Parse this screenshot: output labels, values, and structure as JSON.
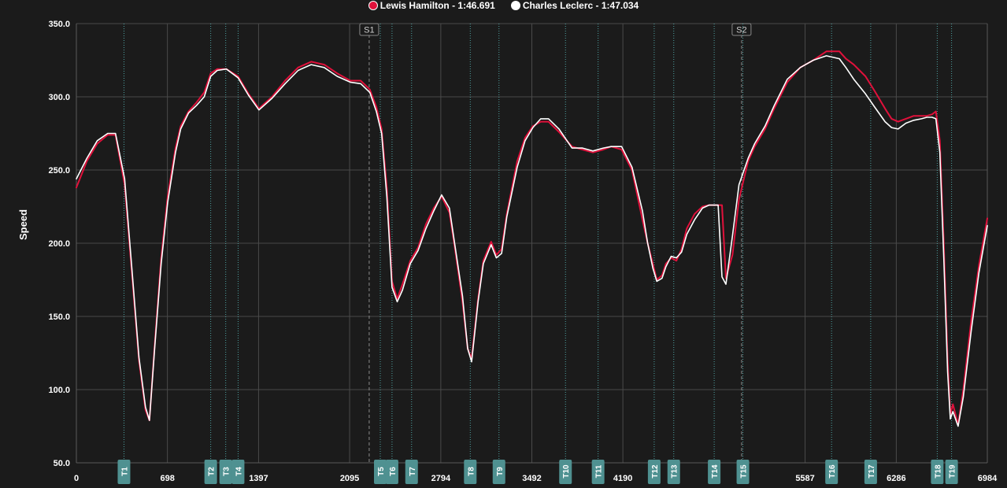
{
  "chart_data": {
    "type": "line",
    "ylabel": "Speed",
    "ylim": [
      50,
      350
    ],
    "xlim": [
      0,
      6984
    ],
    "yticks": [
      "350.0",
      "300.0",
      "250.0",
      "200.0",
      "150.0",
      "100.0",
      "50.0"
    ],
    "yticks_values": [
      350,
      300,
      250,
      200,
      150,
      100,
      50
    ],
    "xticks": [
      "0",
      "698",
      "1397",
      "2095",
      "2794",
      "3492",
      "4190",
      "5587",
      "6286",
      "6984"
    ],
    "xticks_values": [
      0,
      698,
      1397,
      2095,
      2794,
      3492,
      4190,
      5587,
      6286,
      6984
    ],
    "grid": true,
    "legend_position": "top-center",
    "sectors": [
      {
        "label": "S1",
        "x": 2245
      },
      {
        "label": "S2",
        "x": 5100
      }
    ],
    "turns": [
      {
        "label": "T1",
        "x": 365
      },
      {
        "label": "T2",
        "x": 1030
      },
      {
        "label": "T3",
        "x": 1145
      },
      {
        "label": "T4",
        "x": 1240
      },
      {
        "label": "T5",
        "x": 2330
      },
      {
        "label": "T6",
        "x": 2420
      },
      {
        "label": "T7",
        "x": 2570
      },
      {
        "label": "T8",
        "x": 3020
      },
      {
        "label": "T9",
        "x": 3240
      },
      {
        "label": "T10",
        "x": 3750
      },
      {
        "label": "T11",
        "x": 4000
      },
      {
        "label": "T12",
        "x": 4430
      },
      {
        "label": "T13",
        "x": 4580
      },
      {
        "label": "T14",
        "x": 4890
      },
      {
        "label": "T15",
        "x": 5110
      },
      {
        "label": "T16",
        "x": 5790
      },
      {
        "label": "T17",
        "x": 6090
      },
      {
        "label": "T18",
        "x": 6600
      },
      {
        "label": "T19",
        "x": 6710
      }
    ],
    "series": [
      {
        "name": "Lewis Hamilton - 1:46.691",
        "color": "#e0113b",
        "x": [
          0,
          80,
          160,
          240,
          300,
          370,
          430,
          480,
          530,
          560,
          600,
          650,
          700,
          760,
          800,
          860,
          920,
          980,
          1030,
          1080,
          1150,
          1240,
          1320,
          1400,
          1500,
          1600,
          1700,
          1800,
          1900,
          2000,
          2100,
          2180,
          2250,
          2300,
          2340,
          2380,
          2420,
          2460,
          2500,
          2560,
          2620,
          2680,
          2740,
          2800,
          2860,
          2900,
          2960,
          3000,
          3030,
          3080,
          3120,
          3180,
          3220,
          3260,
          3300,
          3380,
          3440,
          3500,
          3560,
          3620,
          3700,
          3800,
          3880,
          3960,
          4040,
          4100,
          4180,
          4260,
          4340,
          4380,
          4420,
          4450,
          4490,
          4520,
          4560,
          4600,
          4640,
          4680,
          4740,
          4800,
          4850,
          4900,
          4920,
          4950,
          4980,
          5030,
          5080,
          5150,
          5200,
          5280,
          5350,
          5450,
          5550,
          5650,
          5750,
          5850,
          5900,
          5960,
          6050,
          6120,
          6200,
          6250,
          6300,
          6360,
          6420,
          6480,
          6520,
          6560,
          6590,
          6620,
          6650,
          6680,
          6700,
          6720,
          6760,
          6800,
          6860,
          6920,
          6984
        ],
        "values": [
          238,
          256,
          268,
          274,
          274,
          240,
          175,
          120,
          86,
          79,
          130,
          190,
          232,
          265,
          280,
          290,
          296,
          303,
          316,
          319,
          319,
          314,
          302,
          292,
          300,
          311,
          320,
          324,
          322,
          316,
          311,
          311,
          305,
          293,
          278,
          238,
          174,
          162,
          172,
          188,
          197,
          213,
          224,
          232,
          221,
          198,
          160,
          128,
          121,
          162,
          188,
          201,
          192,
          196,
          220,
          256,
          272,
          280,
          283,
          283,
          276,
          266,
          264,
          262,
          264,
          266,
          264,
          250,
          216,
          200,
          186,
          175,
          178,
          186,
          190,
          188,
          196,
          210,
          220,
          225,
          226,
          226,
          226,
          226,
          176,
          192,
          230,
          256,
          266,
          278,
          292,
          310,
          320,
          325,
          331,
          331,
          326,
          322,
          314,
          304,
          292,
          285,
          283,
          285,
          287,
          287,
          287,
          288,
          290,
          270,
          200,
          120,
          83,
          90,
          76,
          100,
          147,
          185,
          217
        ]
      },
      {
        "name": "Charles Leclerc - 1:47.034",
        "color": "#ffffff",
        "x": [
          0,
          80,
          160,
          240,
          300,
          370,
          430,
          480,
          530,
          560,
          600,
          650,
          700,
          760,
          800,
          860,
          920,
          980,
          1030,
          1080,
          1150,
          1240,
          1320,
          1400,
          1500,
          1600,
          1700,
          1800,
          1900,
          2000,
          2100,
          2180,
          2250,
          2300,
          2340,
          2380,
          2420,
          2460,
          2500,
          2560,
          2620,
          2680,
          2740,
          2800,
          2860,
          2900,
          2960,
          3000,
          3030,
          3080,
          3120,
          3180,
          3220,
          3260,
          3300,
          3380,
          3440,
          3500,
          3560,
          3620,
          3700,
          3800,
          3880,
          3960,
          4040,
          4100,
          4180,
          4260,
          4340,
          4380,
          4420,
          4450,
          4490,
          4520,
          4560,
          4600,
          4640,
          4680,
          4740,
          4800,
          4850,
          4900,
          4920,
          4950,
          4980,
          5030,
          5080,
          5150,
          5200,
          5280,
          5350,
          5450,
          5550,
          5650,
          5750,
          5850,
          5900,
          5960,
          6050,
          6120,
          6200,
          6250,
          6300,
          6360,
          6420,
          6480,
          6520,
          6560,
          6590,
          6620,
          6650,
          6680,
          6700,
          6720,
          6760,
          6800,
          6860,
          6920,
          6984
        ],
        "values": [
          244,
          258,
          270,
          275,
          275,
          244,
          178,
          122,
          88,
          79,
          128,
          186,
          228,
          262,
          278,
          289,
          294,
          300,
          314,
          318,
          319,
          313,
          301,
          291,
          299,
          309,
          318,
          322,
          320,
          314,
          310,
          309,
          303,
          290,
          275,
          232,
          170,
          160,
          168,
          186,
          195,
          210,
          222,
          233,
          224,
          200,
          164,
          128,
          119,
          160,
          186,
          199,
          190,
          193,
          218,
          252,
          270,
          279,
          285,
          285,
          278,
          265,
          265,
          263,
          265,
          266,
          266,
          252,
          222,
          200,
          183,
          174,
          176,
          184,
          191,
          190,
          194,
          206,
          216,
          224,
          226,
          226,
          226,
          177,
          172,
          205,
          240,
          258,
          268,
          280,
          294,
          312,
          320,
          325,
          328,
          326,
          320,
          312,
          302,
          293,
          283,
          279,
          278,
          282,
          284,
          285,
          286,
          286,
          285,
          262,
          190,
          112,
          80,
          85,
          75,
          95,
          140,
          180,
          212
        ]
      }
    ]
  }
}
